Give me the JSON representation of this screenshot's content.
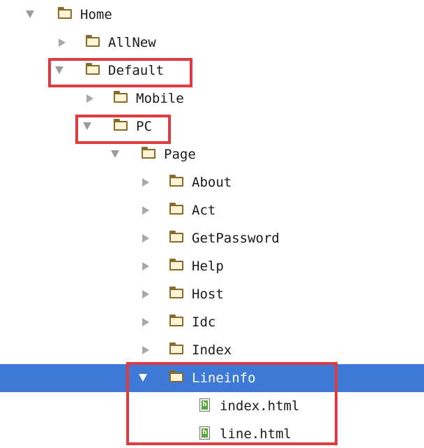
{
  "tree": {
    "home": "Home",
    "allnew": "AllNew",
    "default": "Default",
    "mobile": "Mobile",
    "pc": "PC",
    "page": "Page",
    "about": "About",
    "act": "Act",
    "getpassword": "GetPassword",
    "help": "Help",
    "host": "Host",
    "idc": "Idc",
    "index": "Index",
    "lineinfo": "Lineinfo",
    "index_html": "index.html",
    "line_html": "line.html"
  },
  "file_icon_letter": "h",
  "colors": {
    "selection": "#3d79d7",
    "highlight_box": "#e03a3e",
    "folder_outline": "#8a6a2a",
    "file_badge": "#5ba83a"
  }
}
